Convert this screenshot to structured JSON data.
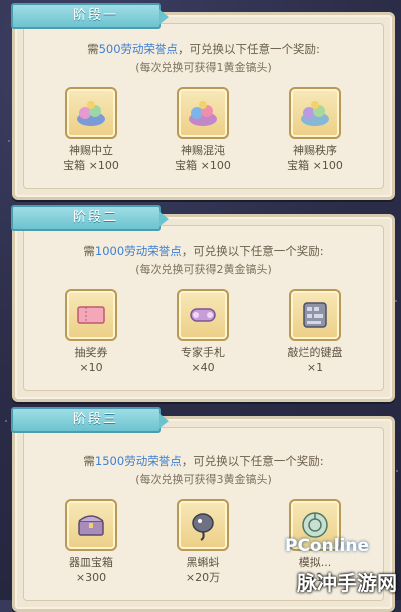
{
  "stages": [
    {
      "tab": "阶段一",
      "requirement_prefix": "需",
      "requirement_highlight": "500劳动荣誉点",
      "requirement_suffix": "，可兑换以下任意一个奖励:",
      "note": "(每次兑换可获得1黄金镐头)",
      "rewards": [
        {
          "icon": "candy-chest-icon",
          "name": "神赐中立\n宝箱 ×100"
        },
        {
          "icon": "candy-chest-icon",
          "name": "神赐混沌\n宝箱 ×100"
        },
        {
          "icon": "candy-chest-icon",
          "name": "神赐秩序\n宝箱 ×100"
        }
      ]
    },
    {
      "tab": "阶段二",
      "requirement_prefix": "需",
      "requirement_highlight": "1000劳动荣誉点",
      "requirement_suffix": "，可兑换以下任意一个奖励:",
      "note": "(每次兑换可获得2黄金镐头)",
      "rewards": [
        {
          "icon": "ticket-icon",
          "name": "抽奖券\n×10"
        },
        {
          "icon": "expert-handbook-icon",
          "name": "专家手札\n×40"
        },
        {
          "icon": "rusty-keyboard-icon",
          "name": "敲烂的键盘\n×1"
        }
      ]
    },
    {
      "tab": "阶段三",
      "requirement_prefix": "需",
      "requirement_highlight": "1500劳动荣誉点",
      "requirement_suffix": "，可兑换以下任意一个奖励:",
      "note": "(每次兑换可获得3黄金镐头)",
      "rewards": [
        {
          "icon": "treasure-chest-icon",
          "name": "器皿宝箱\n×300"
        },
        {
          "icon": "black-bomb-icon",
          "name": "黑蝌蚪\n×20万"
        },
        {
          "icon": "dial-icon",
          "name": "模拟...\n×1"
        }
      ]
    }
  ],
  "watermark": {
    "site": "PConline",
    "app": "脉冲手游网"
  },
  "colors": {
    "tab": "#6cc3d0",
    "highlight": "#3e7fd0",
    "panel": "#efe7d4",
    "background": "#2c2e4a"
  }
}
